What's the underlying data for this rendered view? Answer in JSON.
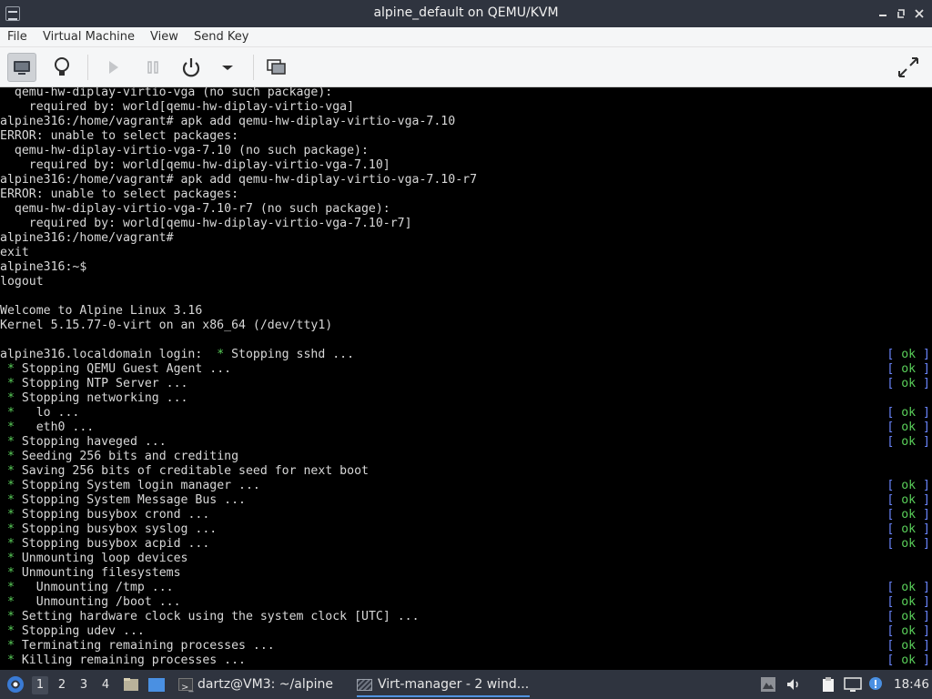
{
  "window": {
    "title": "alpine_default on QEMU/KVM",
    "controls": [
      "minimize-icon",
      "maximize-icon",
      "close-icon"
    ]
  },
  "menu": [
    "File",
    "Virtual Machine",
    "View",
    "Send Key"
  ],
  "toolbar": {
    "buttons": [
      "console-view-icon",
      "details-bulb-icon",
      "run-icon",
      "pause-icon",
      "power-icon",
      "power-menu-chevron-icon",
      "snapshots-icon",
      "fullscreen-icon"
    ]
  },
  "console": {
    "lines": [
      {
        "text": "  qemu-hw-diplay-virtio-vga (no such package):",
        "ok": false
      },
      {
        "text": "    required by: world[qemu-hw-diplay-virtio-vga]",
        "ok": false
      },
      {
        "text": "alpine316:/home/vagrant# apk add qemu-hw-diplay-virtio-vga-7.10",
        "ok": false
      },
      {
        "text": "ERROR: unable to select packages:",
        "ok": false
      },
      {
        "text": "  qemu-hw-diplay-virtio-vga-7.10 (no such package):",
        "ok": false
      },
      {
        "text": "    required by: world[qemu-hw-diplay-virtio-vga-7.10]",
        "ok": false
      },
      {
        "text": "alpine316:/home/vagrant# apk add qemu-hw-diplay-virtio-vga-7.10-r7",
        "ok": false
      },
      {
        "text": "ERROR: unable to select packages:",
        "ok": false
      },
      {
        "text": "  qemu-hw-diplay-virtio-vga-7.10-r7 (no such package):",
        "ok": false
      },
      {
        "text": "    required by: world[qemu-hw-diplay-virtio-vga-7.10-r7]",
        "ok": false
      },
      {
        "text": "alpine316:/home/vagrant#",
        "ok": false
      },
      {
        "text": "exit",
        "ok": false
      },
      {
        "text": "alpine316:~$",
        "ok": false
      },
      {
        "text": "logout",
        "ok": false
      },
      {
        "text": "",
        "ok": false
      },
      {
        "text": "Welcome to Alpine Linux 3.16",
        "ok": false
      },
      {
        "text": "Kernel 5.15.77-0-virt on an x86_64 (/dev/tty1)",
        "ok": false
      },
      {
        "text": "",
        "ok": false
      },
      {
        "text": "alpine316.localdomain login:  * Stopping sshd ...",
        "ok": true
      },
      {
        "text": " * Stopping QEMU Guest Agent ...",
        "ok": true
      },
      {
        "text": " * Stopping NTP Server ...",
        "ok": true
      },
      {
        "text": " * Stopping networking ...",
        "ok": false
      },
      {
        "text": " *   lo ...",
        "ok": true
      },
      {
        "text": " *   eth0 ...",
        "ok": true
      },
      {
        "text": " * Stopping haveged ...",
        "ok": true
      },
      {
        "text": " * Seeding 256 bits and crediting",
        "ok": false
      },
      {
        "text": " * Saving 256 bits of creditable seed for next boot",
        "ok": false
      },
      {
        "text": " * Stopping System login manager ...",
        "ok": true
      },
      {
        "text": " * Stopping System Message Bus ...",
        "ok": true
      },
      {
        "text": " * Stopping busybox crond ...",
        "ok": true
      },
      {
        "text": " * Stopping busybox syslog ...",
        "ok": true
      },
      {
        "text": " * Stopping busybox acpid ...",
        "ok": true
      },
      {
        "text": " * Unmounting loop devices",
        "ok": false
      },
      {
        "text": " * Unmounting filesystems",
        "ok": false
      },
      {
        "text": " *   Unmounting /tmp ...",
        "ok": true
      },
      {
        "text": " *   Unmounting /boot ...",
        "ok": true
      },
      {
        "text": " * Setting hardware clock using the system clock [UTC] ...",
        "ok": true
      },
      {
        "text": " * Stopping udev ...",
        "ok": true
      },
      {
        "text": " * Terminating remaining processes ...",
        "ok": true
      },
      {
        "text": " * Killing remaining processes ...",
        "ok": true
      }
    ],
    "ok_label": "ok"
  },
  "taskbar": {
    "workspaces": [
      "1",
      "2",
      "3",
      "4"
    ],
    "tasks": [
      {
        "icon": "terminal-icon",
        "label": "dartz@VM3: ~/alpine"
      },
      {
        "icon": "virt-manager-icon",
        "label": "Virt-manager - 2 wind..."
      }
    ],
    "tray_icons": [
      "screenshot-icon",
      "volume-icon",
      "clipboard-icon",
      "network-display-icon",
      "update-notifier-icon"
    ],
    "clock": "18:46"
  },
  "colors": {
    "titlebar_bg": "#2f343f",
    "toolbar_bg": "#f5f6f7",
    "console_bg": "#000000",
    "console_text": "#d8d8d8",
    "ok_green": "#5ad05a",
    "bracket_blue": "#6b86ff",
    "accent": "#5294e2"
  }
}
